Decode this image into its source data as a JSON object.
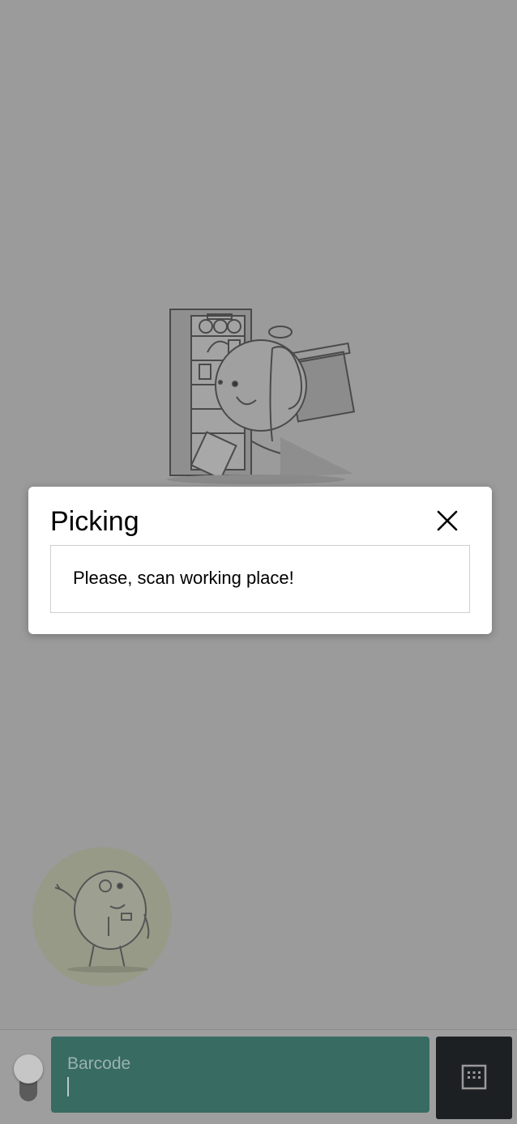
{
  "dialog": {
    "title": "Picking",
    "message": "Please, scan working place!",
    "close_icon": "close-icon"
  },
  "scanner": {
    "barcode_label": "Barcode",
    "barcode_value": "",
    "keyboard_icon": "keyboard-icon",
    "toggle_state": "off"
  },
  "colors": {
    "overlay": "#9b9b9b",
    "barcode_field": "#386b62",
    "keyboard_button": "#1d2022",
    "dialog_background": "#ffffff"
  }
}
